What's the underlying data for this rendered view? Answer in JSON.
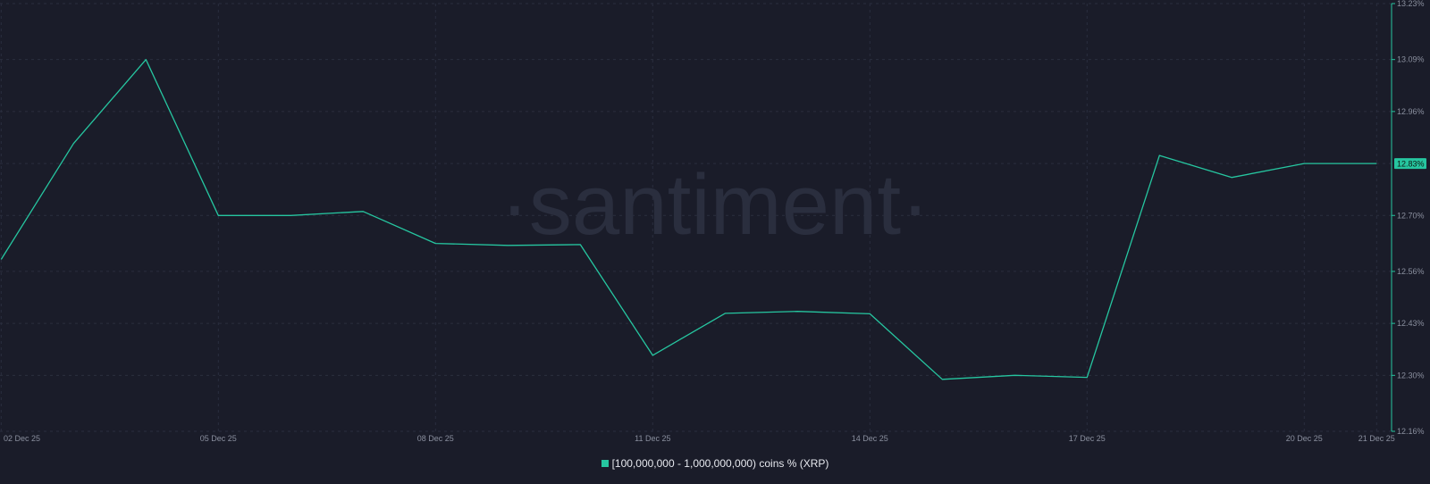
{
  "colors": {
    "background": "#1a1c29",
    "series": "#26c6a0",
    "grid": "#2a2e3e",
    "badge_text": "#0d1a14"
  },
  "watermark": "·santiment·",
  "legend": {
    "label": "[100,000,000 - 1,000,000,000) coins % (XRP)"
  },
  "chart_data": {
    "type": "line",
    "x": [
      "02 Dec 25",
      "03 Dec 25",
      "04 Dec 25",
      "05 Dec 25",
      "06 Dec 25",
      "07 Dec 25",
      "08 Dec 25",
      "09 Dec 25",
      "10 Dec 25",
      "11 Dec 25",
      "12 Dec 25",
      "13 Dec 25",
      "14 Dec 25",
      "15 Dec 25",
      "16 Dec 25",
      "17 Dec 25",
      "18 Dec 25",
      "19 Dec 25",
      "20 Dec 25",
      "21 Dec 25"
    ],
    "series": [
      {
        "name": "[100,000,000 - 1,000,000,000) coins % (XRP)",
        "values": [
          12.59,
          12.88,
          13.09,
          12.7,
          12.7,
          12.71,
          12.63,
          12.625,
          12.627,
          12.35,
          12.455,
          12.46,
          12.454,
          12.29,
          12.3,
          12.295,
          12.85,
          12.795,
          12.83,
          12.83
        ]
      }
    ],
    "x_tick_labels": [
      "02 Dec 25",
      "05 Dec 25",
      "08 Dec 25",
      "11 Dec 25",
      "14 Dec 25",
      "17 Dec 25",
      "20 Dec 25",
      "21 Dec 25"
    ],
    "y_tick_labels": [
      "13.23%",
      "13.09%",
      "12.96%",
      "12.83%",
      "12.70%",
      "12.56%",
      "12.43%",
      "12.30%",
      "12.16%"
    ],
    "ylim": [
      12.16,
      13.23
    ],
    "current_value_label": "12.83%",
    "grid": true,
    "legend_position": "bottom"
  }
}
